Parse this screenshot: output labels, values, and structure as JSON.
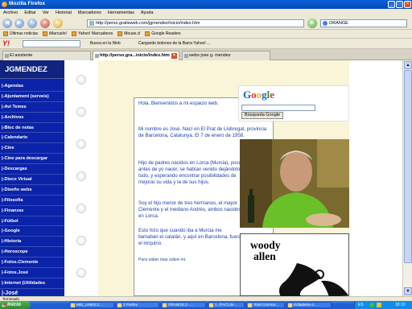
{
  "window": {
    "title": "Mozilla Firefox"
  },
  "menu": [
    "Archivo",
    "Editar",
    "Ver",
    "Historial",
    "Marcadores",
    "Herramientas",
    "Ayuda"
  ],
  "nav": {
    "url": "http://perso.gratisweb.com/jgmendez/inicio/index.htm",
    "search_value": "ORANGE"
  },
  "bookmarks": [
    "Últimas noticias",
    "iMarcarlo!",
    "Yahoo! Marcadores",
    "Mouse.cl",
    "Google Readers"
  ],
  "yahoo": {
    "logo": "Y!",
    "search_label": "Busca en la Web",
    "loading_text": "Cargando botones de la Barra Yahoo! ..."
  },
  "tabs": [
    {
      "label": "El asistente",
      "active": false
    },
    {
      "label": "http://perso.gra...inicio/index.htm",
      "active": true
    },
    {
      "label": "webs jose g. mendez",
      "active": false
    }
  ],
  "sidebar": {
    "header": "JGMENDEZ",
    "items": [
      "Agendas",
      "Ajuntament (serveis)",
      "Avi Temes",
      "Archivos",
      "Bloc de notas",
      "Calendario",
      "Cine",
      "Cine para descargar",
      "Descargas",
      "Disco Virtual",
      "Diseño webs",
      "Filosofía",
      "Finanzas",
      "Fútbol",
      "Google",
      "Historia",
      "Horoscope",
      "Fotos.Clemente",
      "Fotos.José",
      "Internet (Utilidades",
      "José"
    ]
  },
  "main": {
    "greeting": "Hola. Bienvenidos a mi espacio web.",
    "para1": "Mi nombre es José. Nací en El Prat de Llobregat, provincia de Barcelona, Catalunya. El 7 de enero de 1958.",
    "para2": "Hijo de padres nacidos en Lorca (Murcia), poco antes de yo nacer, se habían venido dejándolo todo, y esperando encontrar posibilidades de mejorar su vida y la de sus hijos.",
    "para3": "Soy el hijo menor de tres hermanos, el mayor Clemente y el mediano Andrés, ambos nacidos en Lorca.",
    "para4": "Esto hizo que cuando iba a Murcia me llamaban el catalán, y aquí en Barcelona, fuera el lorquino.",
    "more_link": "Para saber mas sobre mi."
  },
  "google": {
    "logo_letters": [
      "G",
      "o",
      "o",
      "g",
      "l",
      "e"
    ],
    "logo_colors": [
      "#1a5fd8",
      "#d83a2a",
      "#e9b21c",
      "#1a5fd8",
      "#2a9a3a",
      "#d83a2a"
    ],
    "button": "Búsqueda Google"
  },
  "woody": {
    "line1": "woody",
    "line2": "allen"
  },
  "status": "Terminado",
  "taskbar": {
    "start": "Inicio",
    "tasks": [
      "MIS_LINKS.2...",
      "2 Firefox",
      "ORANGE.2 - ...",
      "1. (FAC) de...",
      "Total Comma...",
      "Enfadarse e..."
    ],
    "tray_lang": "ES",
    "time": "18:10"
  }
}
